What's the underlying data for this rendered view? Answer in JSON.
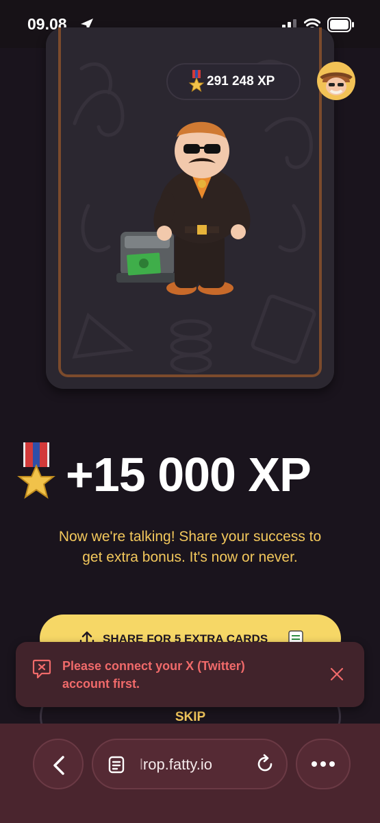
{
  "status_bar": {
    "time": "09.08",
    "icons": [
      "location-arrow-icon",
      "cellular-signal-icon",
      "wifi-icon",
      "battery-icon"
    ]
  },
  "card": {
    "xp_balance": "291 248 XP",
    "icons": [
      "medal-icon",
      "avatar"
    ],
    "illustration": "fatty-mobster-character-with-money-printer"
  },
  "reward": {
    "amount": "+15 000 XP",
    "icon": "medal-icon"
  },
  "message": {
    "line1": "Now we're talking! Share your success to",
    "line2": "get extra bonus. It's now or never."
  },
  "share_button": {
    "label": "SHARE FOR 5 EXTRA CARDS",
    "icons": [
      "share-icon",
      "ticket-icon"
    ]
  },
  "skip_button": {
    "label": "SKIP"
  },
  "toast": {
    "line1": "Please connect your X (Twitter)",
    "line2": "account first.",
    "icons": [
      "error-icon",
      "close-icon"
    ],
    "text_color": "#f06a6a",
    "background": "#41232b"
  },
  "browser_bar": {
    "url_faded_prefix": "l",
    "url": "rop.fatty.io",
    "icons": [
      "back-icon",
      "tabs-icon",
      "reload-icon",
      "more-icon"
    ]
  },
  "colors": {
    "background": "#1a141d",
    "accent_yellow": "#f6d766",
    "gold_text": "#f3c85c",
    "card_border": "#7c4b2c",
    "browser_bar": "#4a252e"
  }
}
